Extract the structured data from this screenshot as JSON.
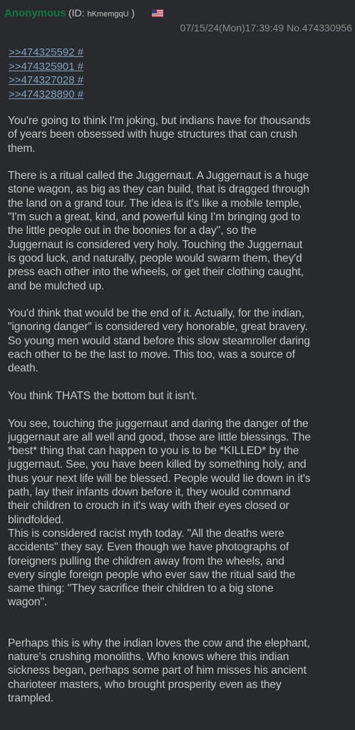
{
  "header": {
    "name": "Anonymous",
    "id_prefix": "(ID: ",
    "id": "hKmemgqU",
    "id_suffix": " )",
    "flag_icon": "us-flag-icon",
    "datetime": "07/15/24(Mon)17:39:49",
    "post_number": "No.474330956"
  },
  "quotes": [
    ">>474325592 #",
    ">>474325901 #",
    ">>474327028 #",
    ">>474328890 #"
  ],
  "paragraphs": [
    "You're going to think I'm joking, but indians have for thousands\nof years been obsessed with huge structures that can crush\nthem.",
    "There is a ritual called the Juggernaut. A Juggernaut is a huge\nstone wagon, as big as they can build, that is dragged through\nthe land on a grand tour. The idea is it's like a mobile temple,\n\"I'm such a great, kind, and powerful king I'm bringing god to\nthe little people out in the boonies for a day\", so the\nJuggernaut is considered very holy. Touching the Juggernaut\nis good luck, and naturally, people would swarm them, they'd\npress each other into the wheels, or get their clothing caught,\nand be mulched up.",
    "You'd think that would be the end of it. Actually, for the indian,\n\"ignoring danger\" is considered very honorable, great bravery.\nSo young men would stand before this slow steamroller daring\neach other to be the last to move. This too, was a source of\ndeath.",
    "You think THATS the bottom but it isn't.",
    "You see, touching the juggernaut and daring the danger of the\njuggernaut are all well and good, those are little blessings. The\n*best* thing that can happen to you is to be *KILLED* by the\njuggernaut. See, you have been killed by something holy, and\nthus your next life will be blessed. People would lie down in it's\npath, lay their infants down before it, they would command\ntheir children to crouch in it's way with their eyes closed or\nblindfolded.\nThis is considered racist myth today. \"All the deaths were\naccidents\" they say. Even though we have photographs of\nforeigners pulling the children away from the wheels, and\nevery single foreign people who ever saw the ritual said the\nsame thing: \"They sacrifice their children to a big stone\nwagon\".",
    "Perhaps this is why the indian loves the cow and the elephant,\nnature's crushing monoliths. Who knows where this indian\nsickness began, perhaps some part of him misses his ancient\ncharioteer masters, who brought prosperity even as they\ntrampled."
  ],
  "colors": {
    "background": "#282a2e",
    "name": "#117743",
    "text": "#c5c8c6",
    "link": "#81a2be",
    "date": "#898d8a"
  }
}
